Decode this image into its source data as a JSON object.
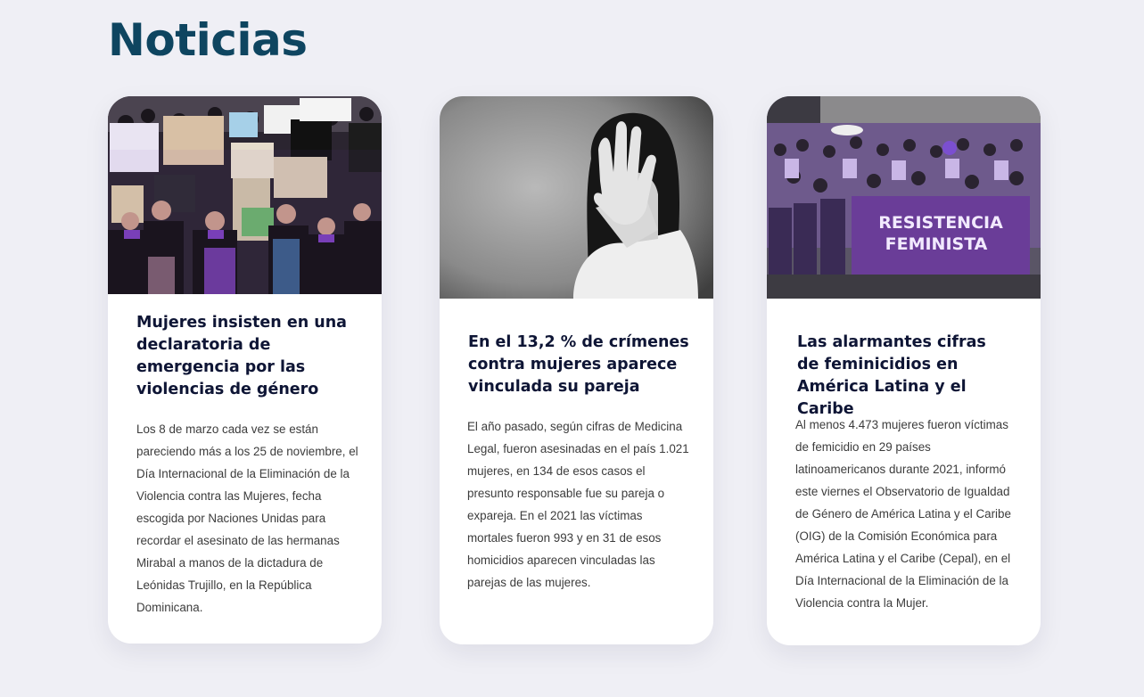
{
  "section": {
    "title": "Noticias"
  },
  "colors": {
    "background": "#efeff5",
    "title": "#0e4560",
    "card_title": "#0e1535",
    "card_text": "#3c3c3c",
    "accent_purple": "#7a3fb8"
  },
  "cards": [
    {
      "image_alt": "protest-crowd-photo",
      "title": "Mujeres insisten en una declaratoria de emergencia por las violencias de género",
      "body": "Los 8 de marzo cada vez se están pareciendo más a los 25 de noviembre, el Día Internacional de la Eliminación de la Violencia contra las Mujeres, fecha escogida por Naciones Unidas para recordar el asesinato de las hermanas Mirabal a manos de la dictadura de Leónidas Trujillo, en la República Dominicana."
    },
    {
      "image_alt": "woman-raised-hand-photo",
      "title": "En el 13,2 % de crímenes contra mujeres aparece vinculada su pareja",
      "body": "El año pasado, según cifras de Medicina Legal, fueron asesinadas en el país 1.021 mujeres, en 134 de esos casos el presunto responsable fue su pareja o expareja. En el 2021 las víctimas mortales fueron 993 y en 31 de esos homicidios aparecen vinculadas las parejas de las mujeres."
    },
    {
      "image_alt": "feminist-march-photo",
      "banner_text_1": "RESISTENCIA",
      "banner_text_2": "FEMINISTA",
      "title": "Las alarmantes cifras de feminicidios en América Latina y el Caribe",
      "body": "Al menos 4.473 mujeres fueron víctimas de femicidio en 29 países latinoamericanos durante 2021, informó este viernes el Observatorio de Igualdad de Género de América Latina y el Caribe (OIG) de la Comisión Económica para América Latina y el Caribe (Cepal), en el Día Internacional de la Eliminación de la Violencia contra la Mujer."
    }
  ]
}
